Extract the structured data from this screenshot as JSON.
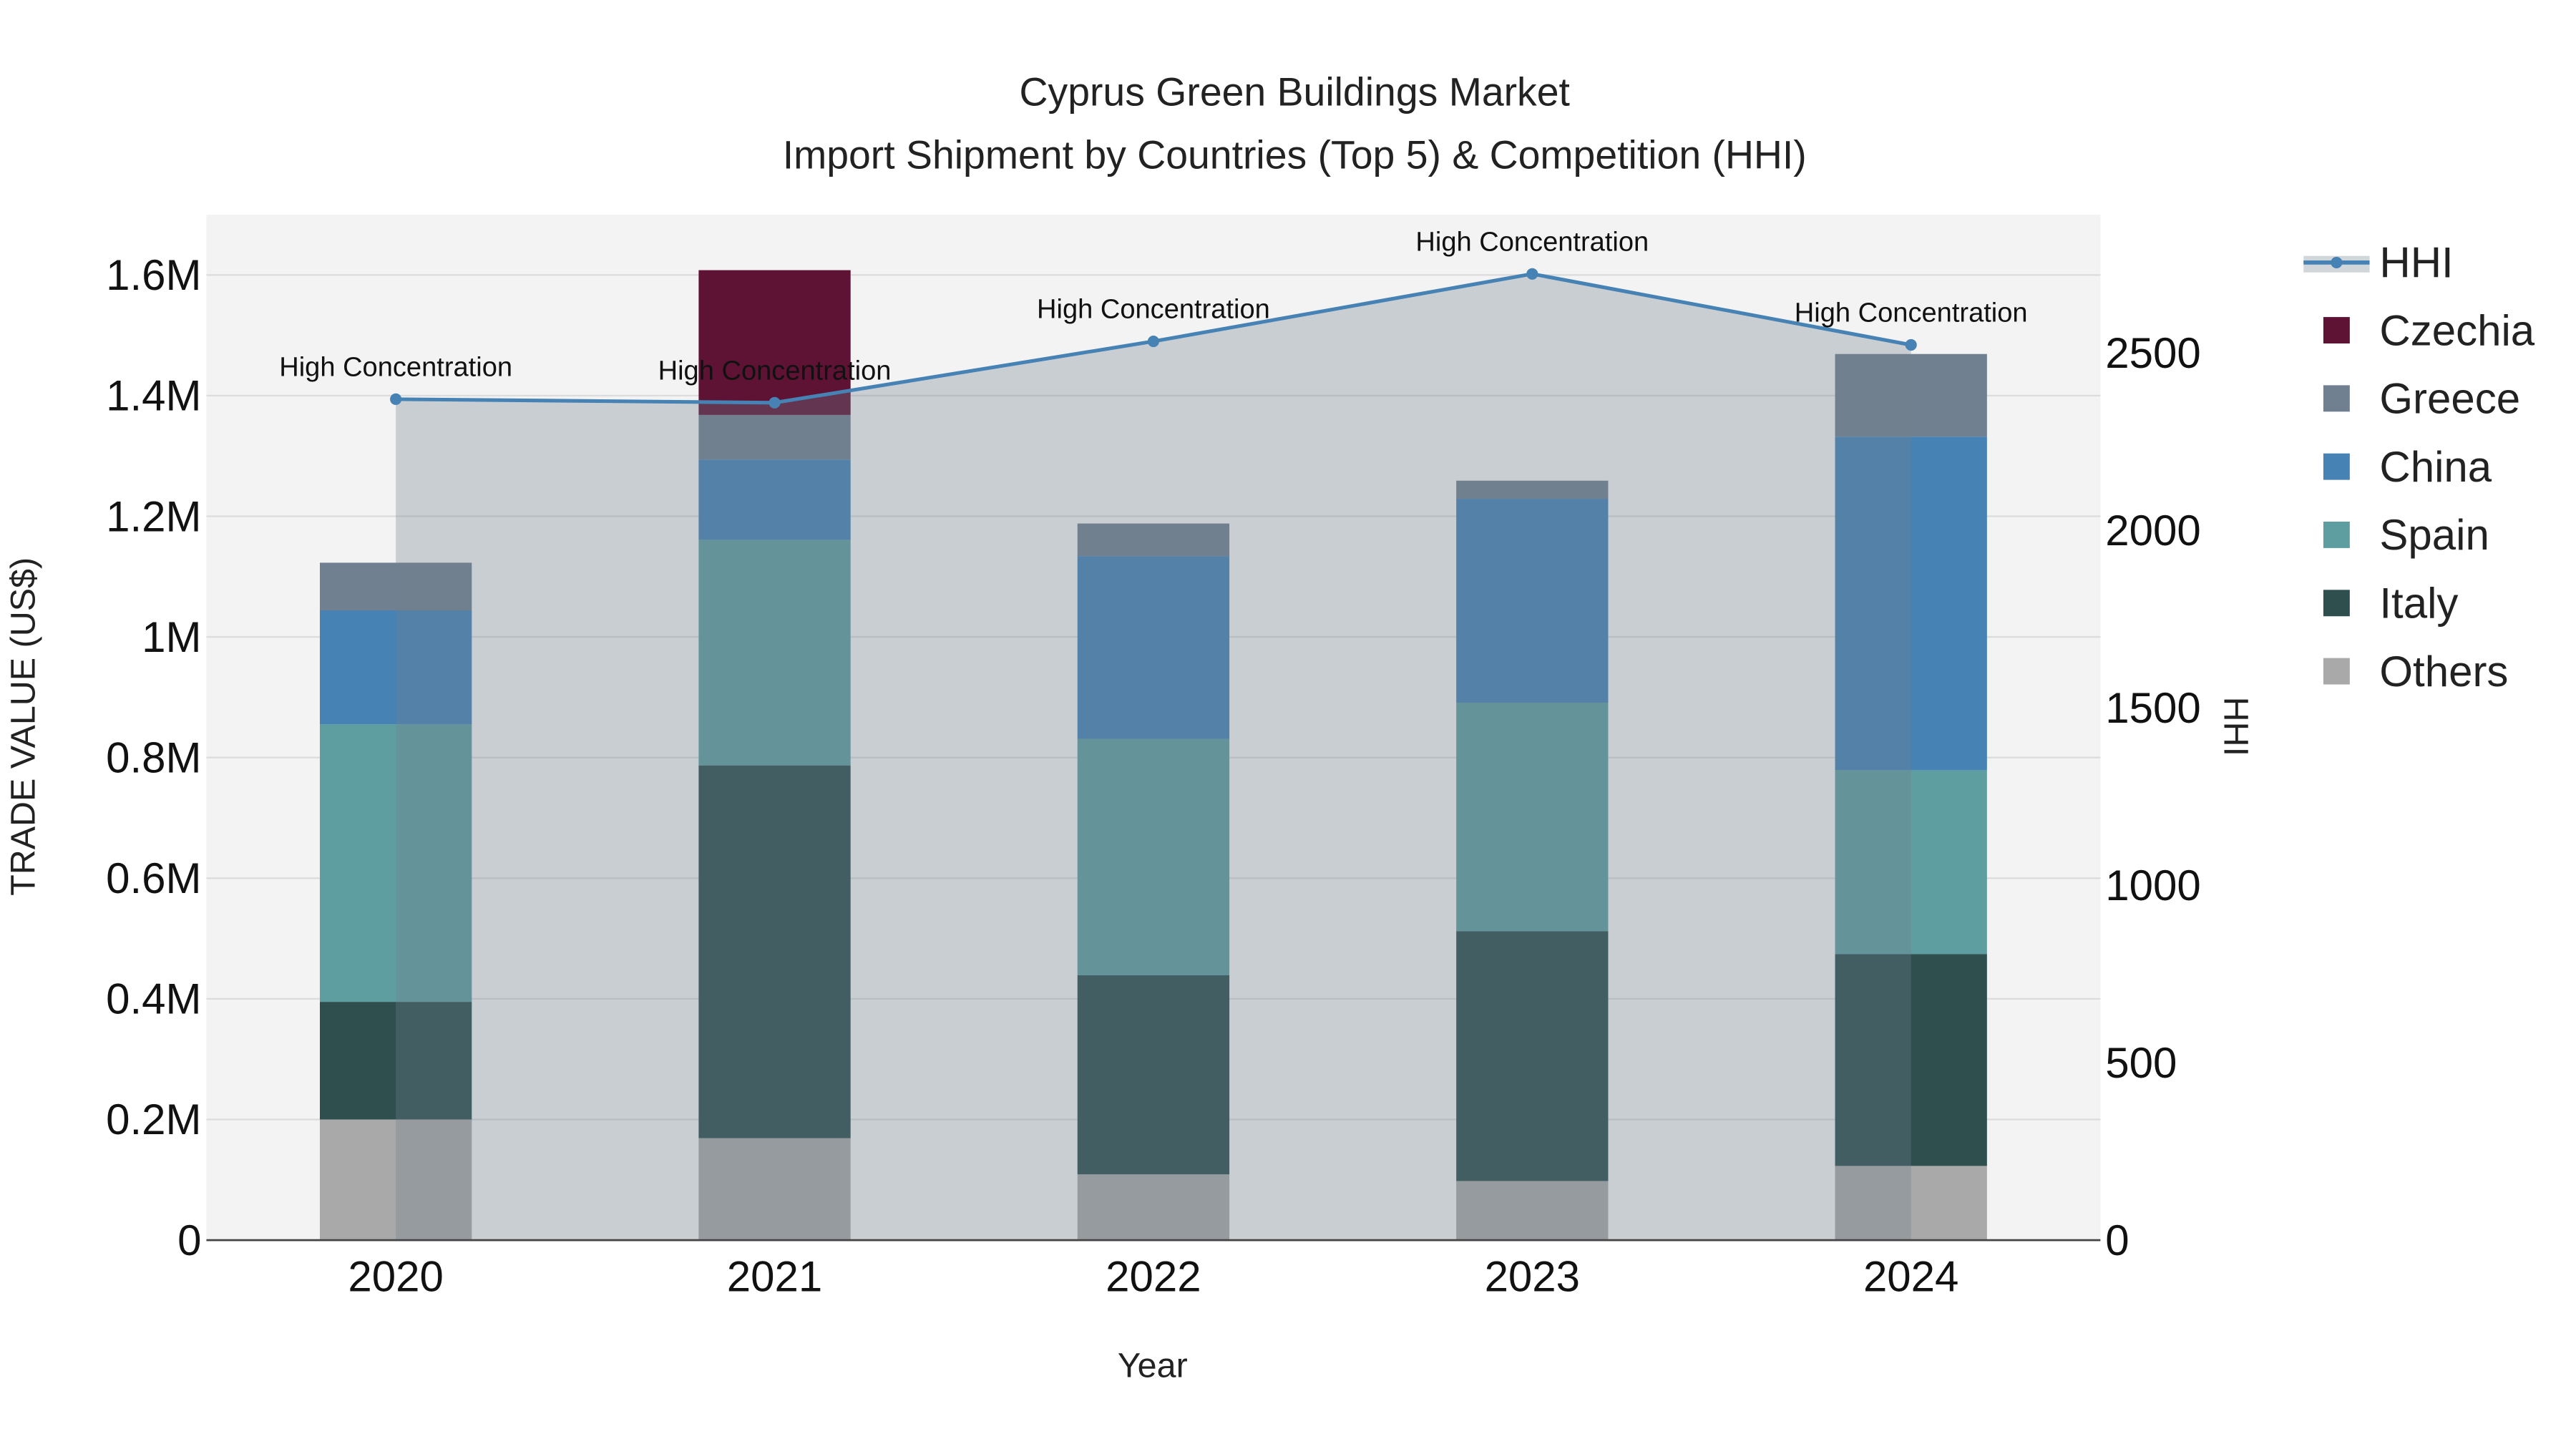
{
  "chart_data": {
    "type": "bar",
    "stacked": true,
    "title": "Cyprus Green Buildings Market",
    "subtitle": "Import Shipment by Countries (Top 5) & Competition (HHI)",
    "xlabel": "Year",
    "ylabel": "TRADE VALUE (US$)",
    "y2label": "HHI",
    "categories": [
      "2020",
      "2021",
      "2022",
      "2023",
      "2024"
    ],
    "ylim": [
      0,
      1700000
    ],
    "y2lim": [
      0,
      2890
    ],
    "yticks": [
      0,
      200000,
      400000,
      600000,
      800000,
      1000000,
      1200000,
      1400000,
      1600000
    ],
    "ytick_labels": [
      "0",
      "0.2M",
      "0.4M",
      "0.6M",
      "0.8M",
      "1M",
      "1.2M",
      "1.4M",
      "1.6M"
    ],
    "y2ticks": [
      0,
      500,
      1000,
      1500,
      2000,
      2500
    ],
    "y2tick_labels": [
      "0",
      "500",
      "1000",
      "1500",
      "2000",
      "2500"
    ],
    "grid": true,
    "legend_position": "right",
    "series": [
      {
        "name": "Others",
        "color": "#a9a9a9",
        "values": [
          200000,
          169000,
          109000,
          98000,
          123000
        ]
      },
      {
        "name": "Italy",
        "color": "#2f4f4f",
        "values": [
          195000,
          618000,
          330000,
          414000,
          351000
        ]
      },
      {
        "name": "Spain",
        "color": "#5f9ea0",
        "values": [
          460000,
          374000,
          392000,
          379000,
          305000
        ]
      },
      {
        "name": "China",
        "color": "#4682b4",
        "values": [
          189000,
          133000,
          303000,
          338000,
          553000
        ]
      },
      {
        "name": "Greece",
        "color": "#708090",
        "values": [
          79000,
          74000,
          54000,
          30000,
          137000
        ]
      },
      {
        "name": "Czechia",
        "color": "#5e1234",
        "values": [
          0,
          240000,
          0,
          0,
          0
        ]
      }
    ],
    "line": {
      "name": "HHI",
      "color": "#4682b4",
      "axis": "right",
      "values": [
        2370,
        2360,
        2533,
        2723,
        2523
      ],
      "annotations": [
        "High Concentration",
        "High Concentration",
        "High Concentration",
        "High Concentration",
        "High Concentration"
      ]
    },
    "legend": [
      "HHI",
      "Czechia",
      "Greece",
      "China",
      "Spain",
      "Italy",
      "Others"
    ]
  }
}
